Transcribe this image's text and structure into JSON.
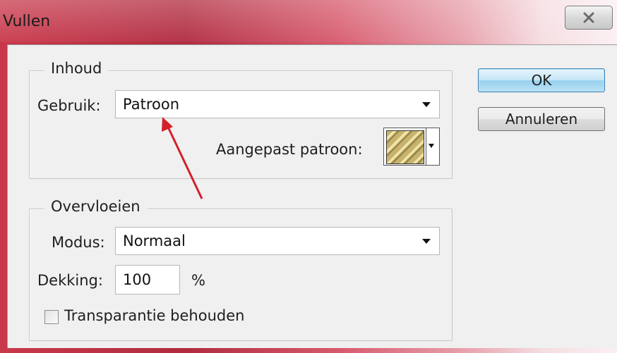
{
  "window": {
    "title": "Vullen"
  },
  "contents_group": {
    "legend": "Inhoud",
    "use_label": "Gebruik:",
    "use_value": "Patroon",
    "custom_pattern_label": "Aangepast patroon:"
  },
  "blending_group": {
    "legend": "Overvloeien",
    "mode_label": "Modus:",
    "mode_value": "Normaal",
    "opacity_label": "Dekking:",
    "opacity_value": "100",
    "opacity_unit": "%",
    "preserve_transparency_label": "Transparantie behouden",
    "preserve_transparency_checked": false
  },
  "buttons": {
    "ok": "OK",
    "cancel": "Annuleren"
  },
  "colors": {
    "annotation_arrow": "#d4202a",
    "accent_button": "#98d1ef"
  },
  "icons": {
    "close": "close-icon",
    "dropdown": "chevron-down-icon"
  }
}
